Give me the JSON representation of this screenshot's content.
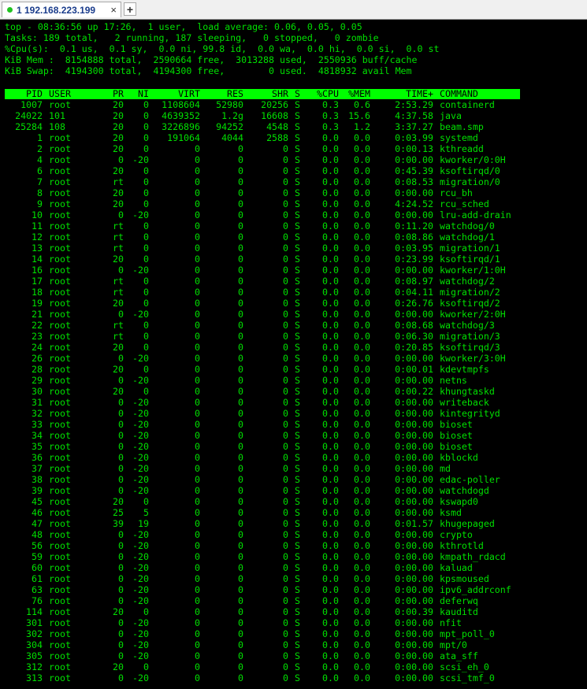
{
  "tab": {
    "label": "1 192.168.223.199",
    "close": "×",
    "new": "+"
  },
  "summary": [
    "top - 08:36:56 up 17:26,  1 user,  load average: 0.06, 0.05, 0.05",
    "Tasks: 189 total,   2 running, 187 sleeping,   0 stopped,   0 zombie",
    "%Cpu(s):  0.1 us,  0.1 sy,  0.0 ni, 99.8 id,  0.0 wa,  0.0 hi,  0.0 si,  0.0 st",
    "KiB Mem :  8154888 total,  2590664 free,  3013288 used,  2550936 buff/cache",
    "KiB Swap:  4194300 total,  4194300 free,        0 used.  4818932 avail Mem"
  ],
  "columns": [
    "PID",
    "USER",
    "PR",
    "NI",
    "VIRT",
    "RES",
    "SHR",
    "S",
    "%CPU",
    "%MEM",
    "TIME+",
    "COMMAND"
  ],
  "processes": [
    [
      "1007",
      "root",
      "20",
      "0",
      "1108604",
      "52980",
      "20256",
      "S",
      "0.3",
      "0.6",
      "2:53.29",
      "containerd"
    ],
    [
      "24022",
      "101",
      "20",
      "0",
      "4639352",
      "1.2g",
      "16608",
      "S",
      "0.3",
      "15.6",
      "4:37.58",
      "java"
    ],
    [
      "25284",
      "108",
      "20",
      "0",
      "3226896",
      "94252",
      "4548",
      "S",
      "0.3",
      "1.2",
      "3:37.27",
      "beam.smp"
    ],
    [
      "1",
      "root",
      "20",
      "0",
      "191064",
      "4044",
      "2588",
      "S",
      "0.0",
      "0.0",
      "0:03.99",
      "systemd"
    ],
    [
      "2",
      "root",
      "20",
      "0",
      "0",
      "0",
      "0",
      "S",
      "0.0",
      "0.0",
      "0:00.13",
      "kthreadd"
    ],
    [
      "4",
      "root",
      "0",
      "-20",
      "0",
      "0",
      "0",
      "S",
      "0.0",
      "0.0",
      "0:00.00",
      "kworker/0:0H"
    ],
    [
      "6",
      "root",
      "20",
      "0",
      "0",
      "0",
      "0",
      "S",
      "0.0",
      "0.0",
      "0:45.39",
      "ksoftirqd/0"
    ],
    [
      "7",
      "root",
      "rt",
      "0",
      "0",
      "0",
      "0",
      "S",
      "0.0",
      "0.0",
      "0:08.53",
      "migration/0"
    ],
    [
      "8",
      "root",
      "20",
      "0",
      "0",
      "0",
      "0",
      "S",
      "0.0",
      "0.0",
      "0:00.00",
      "rcu_bh"
    ],
    [
      "9",
      "root",
      "20",
      "0",
      "0",
      "0",
      "0",
      "S",
      "0.0",
      "0.0",
      "4:24.52",
      "rcu_sched"
    ],
    [
      "10",
      "root",
      "0",
      "-20",
      "0",
      "0",
      "0",
      "S",
      "0.0",
      "0.0",
      "0:00.00",
      "lru-add-drain"
    ],
    [
      "11",
      "root",
      "rt",
      "0",
      "0",
      "0",
      "0",
      "S",
      "0.0",
      "0.0",
      "0:11.20",
      "watchdog/0"
    ],
    [
      "12",
      "root",
      "rt",
      "0",
      "0",
      "0",
      "0",
      "S",
      "0.0",
      "0.0",
      "0:08.86",
      "watchdog/1"
    ],
    [
      "13",
      "root",
      "rt",
      "0",
      "0",
      "0",
      "0",
      "S",
      "0.0",
      "0.0",
      "0:03.95",
      "migration/1"
    ],
    [
      "14",
      "root",
      "20",
      "0",
      "0",
      "0",
      "0",
      "S",
      "0.0",
      "0.0",
      "0:23.99",
      "ksoftirqd/1"
    ],
    [
      "16",
      "root",
      "0",
      "-20",
      "0",
      "0",
      "0",
      "S",
      "0.0",
      "0.0",
      "0:00.00",
      "kworker/1:0H"
    ],
    [
      "17",
      "root",
      "rt",
      "0",
      "0",
      "0",
      "0",
      "S",
      "0.0",
      "0.0",
      "0:08.97",
      "watchdog/2"
    ],
    [
      "18",
      "root",
      "rt",
      "0",
      "0",
      "0",
      "0",
      "S",
      "0.0",
      "0.0",
      "0:04.11",
      "migration/2"
    ],
    [
      "19",
      "root",
      "20",
      "0",
      "0",
      "0",
      "0",
      "S",
      "0.0",
      "0.0",
      "0:26.76",
      "ksoftirqd/2"
    ],
    [
      "21",
      "root",
      "0",
      "-20",
      "0",
      "0",
      "0",
      "S",
      "0.0",
      "0.0",
      "0:00.00",
      "kworker/2:0H"
    ],
    [
      "22",
      "root",
      "rt",
      "0",
      "0",
      "0",
      "0",
      "S",
      "0.0",
      "0.0",
      "0:08.68",
      "watchdog/3"
    ],
    [
      "23",
      "root",
      "rt",
      "0",
      "0",
      "0",
      "0",
      "S",
      "0.0",
      "0.0",
      "0:06.30",
      "migration/3"
    ],
    [
      "24",
      "root",
      "20",
      "0",
      "0",
      "0",
      "0",
      "S",
      "0.0",
      "0.0",
      "0:20.85",
      "ksoftirqd/3"
    ],
    [
      "26",
      "root",
      "0",
      "-20",
      "0",
      "0",
      "0",
      "S",
      "0.0",
      "0.0",
      "0:00.00",
      "kworker/3:0H"
    ],
    [
      "28",
      "root",
      "20",
      "0",
      "0",
      "0",
      "0",
      "S",
      "0.0",
      "0.0",
      "0:00.01",
      "kdevtmpfs"
    ],
    [
      "29",
      "root",
      "0",
      "-20",
      "0",
      "0",
      "0",
      "S",
      "0.0",
      "0.0",
      "0:00.00",
      "netns"
    ],
    [
      "30",
      "root",
      "20",
      "0",
      "0",
      "0",
      "0",
      "S",
      "0.0",
      "0.0",
      "0:00.22",
      "khungtaskd"
    ],
    [
      "31",
      "root",
      "0",
      "-20",
      "0",
      "0",
      "0",
      "S",
      "0.0",
      "0.0",
      "0:00.00",
      "writeback"
    ],
    [
      "32",
      "root",
      "0",
      "-20",
      "0",
      "0",
      "0",
      "S",
      "0.0",
      "0.0",
      "0:00.00",
      "kintegrityd"
    ],
    [
      "33",
      "root",
      "0",
      "-20",
      "0",
      "0",
      "0",
      "S",
      "0.0",
      "0.0",
      "0:00.00",
      "bioset"
    ],
    [
      "34",
      "root",
      "0",
      "-20",
      "0",
      "0",
      "0",
      "S",
      "0.0",
      "0.0",
      "0:00.00",
      "bioset"
    ],
    [
      "35",
      "root",
      "0",
      "-20",
      "0",
      "0",
      "0",
      "S",
      "0.0",
      "0.0",
      "0:00.00",
      "bioset"
    ],
    [
      "36",
      "root",
      "0",
      "-20",
      "0",
      "0",
      "0",
      "S",
      "0.0",
      "0.0",
      "0:00.00",
      "kblockd"
    ],
    [
      "37",
      "root",
      "0",
      "-20",
      "0",
      "0",
      "0",
      "S",
      "0.0",
      "0.0",
      "0:00.00",
      "md"
    ],
    [
      "38",
      "root",
      "0",
      "-20",
      "0",
      "0",
      "0",
      "S",
      "0.0",
      "0.0",
      "0:00.00",
      "edac-poller"
    ],
    [
      "39",
      "root",
      "0",
      "-20",
      "0",
      "0",
      "0",
      "S",
      "0.0",
      "0.0",
      "0:00.00",
      "watchdogd"
    ],
    [
      "45",
      "root",
      "20",
      "0",
      "0",
      "0",
      "0",
      "S",
      "0.0",
      "0.0",
      "0:00.00",
      "kswapd0"
    ],
    [
      "46",
      "root",
      "25",
      "5",
      "0",
      "0",
      "0",
      "S",
      "0.0",
      "0.0",
      "0:00.00",
      "ksmd"
    ],
    [
      "47",
      "root",
      "39",
      "19",
      "0",
      "0",
      "0",
      "S",
      "0.0",
      "0.0",
      "0:01.57",
      "khugepaged"
    ],
    [
      "48",
      "root",
      "0",
      "-20",
      "0",
      "0",
      "0",
      "S",
      "0.0",
      "0.0",
      "0:00.00",
      "crypto"
    ],
    [
      "56",
      "root",
      "0",
      "-20",
      "0",
      "0",
      "0",
      "S",
      "0.0",
      "0.0",
      "0:00.00",
      "kthrotld"
    ],
    [
      "59",
      "root",
      "0",
      "-20",
      "0",
      "0",
      "0",
      "S",
      "0.0",
      "0.0",
      "0:00.00",
      "kmpath_rdacd"
    ],
    [
      "60",
      "root",
      "0",
      "-20",
      "0",
      "0",
      "0",
      "S",
      "0.0",
      "0.0",
      "0:00.00",
      "kaluad"
    ],
    [
      "61",
      "root",
      "0",
      "-20",
      "0",
      "0",
      "0",
      "S",
      "0.0",
      "0.0",
      "0:00.00",
      "kpsmoused"
    ],
    [
      "63",
      "root",
      "0",
      "-20",
      "0",
      "0",
      "0",
      "S",
      "0.0",
      "0.0",
      "0:00.00",
      "ipv6_addrconf"
    ],
    [
      "76",
      "root",
      "0",
      "-20",
      "0",
      "0",
      "0",
      "S",
      "0.0",
      "0.0",
      "0:00.00",
      "deferwq"
    ],
    [
      "114",
      "root",
      "20",
      "0",
      "0",
      "0",
      "0",
      "S",
      "0.0",
      "0.0",
      "0:00.39",
      "kauditd"
    ],
    [
      "301",
      "root",
      "0",
      "-20",
      "0",
      "0",
      "0",
      "S",
      "0.0",
      "0.0",
      "0:00.00",
      "nfit"
    ],
    [
      "302",
      "root",
      "0",
      "-20",
      "0",
      "0",
      "0",
      "S",
      "0.0",
      "0.0",
      "0:00.00",
      "mpt_poll_0"
    ],
    [
      "304",
      "root",
      "0",
      "-20",
      "0",
      "0",
      "0",
      "S",
      "0.0",
      "0.0",
      "0:00.00",
      "mpt/0"
    ],
    [
      "305",
      "root",
      "0",
      "-20",
      "0",
      "0",
      "0",
      "S",
      "0.0",
      "0.0",
      "0:00.00",
      "ata_sff"
    ],
    [
      "312",
      "root",
      "20",
      "0",
      "0",
      "0",
      "0",
      "S",
      "0.0",
      "0.0",
      "0:00.00",
      "scsi_eh_0"
    ],
    [
      "313",
      "root",
      "0",
      "-20",
      "0",
      "0",
      "0",
      "S",
      "0.0",
      "0.0",
      "0:00.00",
      "scsi_tmf_0"
    ]
  ],
  "colors": {
    "terminal_bg": "#000000",
    "terminal_fg": "#00e000",
    "header_bg": "#00ff00",
    "status_connected": "#22c322"
  }
}
